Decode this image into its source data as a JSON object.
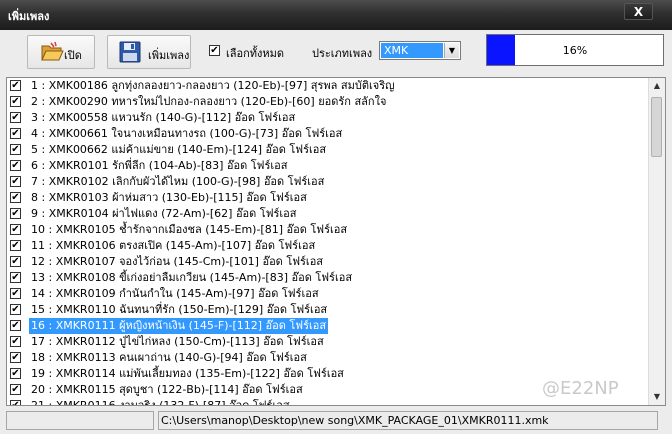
{
  "window": {
    "title": "เพิ่มเพลง",
    "close_label": "X"
  },
  "toolbar": {
    "open_label": "เปิด",
    "add_label": "เพิ่มเพลง",
    "select_all_label": "เลือกทั้งหมด",
    "select_all_checked": true,
    "type_label": "ประเภทเพลง",
    "type_value": "XMK",
    "progress_text": "16%",
    "progress_fraction": 0.16,
    "open_icon": "folder-open-icon",
    "add_icon": "floppy-disk-icon"
  },
  "list": {
    "selected_index": 15,
    "items": [
      "1 : XMK00186 ลูกทุ่งกลองยาว-กลองยาว (120-Eb)-[97] สุรพล สมบัติเจริญ",
      "2 : XMK00290 ทหารใหม่ไปกอง-กลองยาว (120-Eb)-[60] ยอดรัก สลักใจ",
      "3 : XMK00558 แหวนรัก (140-G)-[112] อ๊อด โฟร์เอส",
      "4 : XMK00661 ใจนางเหมือนทางรถ (100-G)-[73] อ๊อด โฟร์เอส",
      "5 : XMK00662 แม่ค้าแม่ขาย (140-Em)-[124] อ๊อด โฟร์เอส",
      "6 : XMKR0101 รักพี่ลีก (104-Ab)-[83] อ๊อด โฟร์เอส",
      "7 : XMKR0102 เลิกกับผัวได้ไหม (100-G)-[98] อ๊อด โฟร์เอส",
      "8 : XMKR0103 ผ้าห่มสาว (130-Eb)-[115] อ๊อด โฟร์เอส",
      "9 : XMKR0104 ผ่าไฟแดง (72-Am)-[62] อ๊อด โฟร์เอส",
      "10 : XMKR0105 ช้ำรักจากเมืองชล (145-Em)-[81] อ๊อด โฟร์เอส",
      "11 : XMKR0106 ตรงสเปิค (145-Am)-[107] อ๊อด โฟร์เอส",
      "12 : XMKR0107 จองไว้ก่อน (145-Cm)-[101] อ๊อด โฟร์เอส",
      "13 : XMKR0108 ขี้เก่งอย่าลืมเกวียน (145-Am)-[83] อ๊อด โฟร์เอส",
      "14 : XMKR0109 กำนันกำใน (145-Am)-[97] อ๊อด โฟร์เอส",
      "15 : XMKR0110 ฉันทนาที่รัก (150-Em)-[129] อ๊อด โฟร์เอส",
      "16 : XMKR0111 ผู้หญิงหน้าเงิน (145-F)-[112] อ๊อด โฟร์เอส",
      "17 : XMKR0112 ปู่ไข่ไก่หลง (150-Cm)-[113] อ๊อด โฟร์เอส",
      "18 : XMKR0113 คนเผาถ่าน (140-G)-[94] อ๊อด โฟร์เอส",
      "19 : XMKR0114 แม่พันเลี้ยมทอง (135-Em)-[122] อ๊อด โฟร์เอส",
      "20 : XMKR0115 สุดบูชา (122-Bb)-[114] อ๊อด โฟร์เอส",
      "21 : XMKR0116 งามจริง (132-F)-[87] อ๊อด โฟร์เอส"
    ]
  },
  "watermark": "@E22NP",
  "status": {
    "path": "C:\\Users\\manop\\Desktop\\new song\\XMK_PACKAGE_01\\XMKR0111.xmk"
  }
}
